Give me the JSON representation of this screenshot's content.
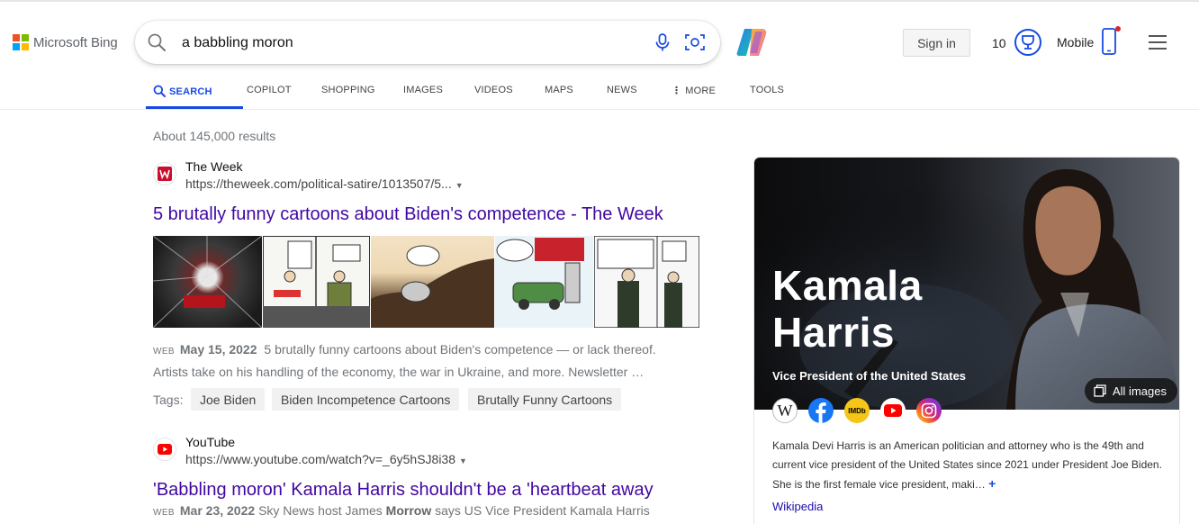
{
  "header": {
    "logo_text": "Microsoft Bing",
    "search_value": "a babbling moron",
    "signin_label": "Sign in",
    "rewards_count": "10",
    "mobile_label": "Mobile"
  },
  "nav": {
    "tabs": [
      "SEARCH",
      "COPILOT",
      "SHOPPING",
      "IMAGES",
      "VIDEOS",
      "MAPS",
      "NEWS",
      "MORE",
      "TOOLS"
    ]
  },
  "results": {
    "count": "About 145,000 results",
    "items": [
      {
        "site": "The Week",
        "url": "https://theweek.com/political-satire/1013507/5...",
        "title": "5 brutally funny cartoons about Biden's competence - The Week",
        "web_tag": "WEB",
        "date": "May 15, 2022",
        "snippet_a": "5 brutally funny cartoons about Biden's competence — or lack thereof.",
        "snippet_b": "Artists take on his handling of the economy, the war in Ukraine, and more. Newsletter …",
        "tags_label": "Tags:",
        "tags": [
          "Joe Biden",
          "Biden Incompetence Cartoons",
          "Brutally Funny Cartoons"
        ]
      },
      {
        "site": "YouTube",
        "url": "https://www.youtube.com/watch?v=_6y5hSJ8i38",
        "title": "'Babbling moron' Kamala Harris shouldn't be a 'heartbeat away",
        "web_tag": "WEB",
        "date": "Mar 23, 2022",
        "snippet_pre": "Sky News host James",
        "snippet_bold": "Morrow",
        "snippet_post": "says US Vice President Kamala Harris"
      }
    ]
  },
  "knowledge_panel": {
    "name_line1": "Kamala",
    "name_line2": "Harris",
    "subtitle": "Vice President of the United States",
    "all_images_label": "All images",
    "imdb_label": "IMDb",
    "wiki_glyph": "W",
    "description": "Kamala Devi Harris is an American politician and attorney who is the 49th and current vice president of the United States since 2021 under President Joe Biden. She is the first female vice president, maki…",
    "more_glyph": "+",
    "source_link": "Wikipedia"
  },
  "colors": {
    "accent": "#174ae4",
    "visited_link": "#4007a2",
    "logo": [
      "#f25022",
      "#7fba00",
      "#00a4ef",
      "#ffb900"
    ]
  },
  "icons": [
    "search-icon",
    "microphone-icon",
    "visual-search-icon",
    "copilot-icon",
    "rewards-trophy-icon",
    "mobile-phone-icon",
    "hamburger-menu-icon",
    "more-dots-icon"
  ]
}
